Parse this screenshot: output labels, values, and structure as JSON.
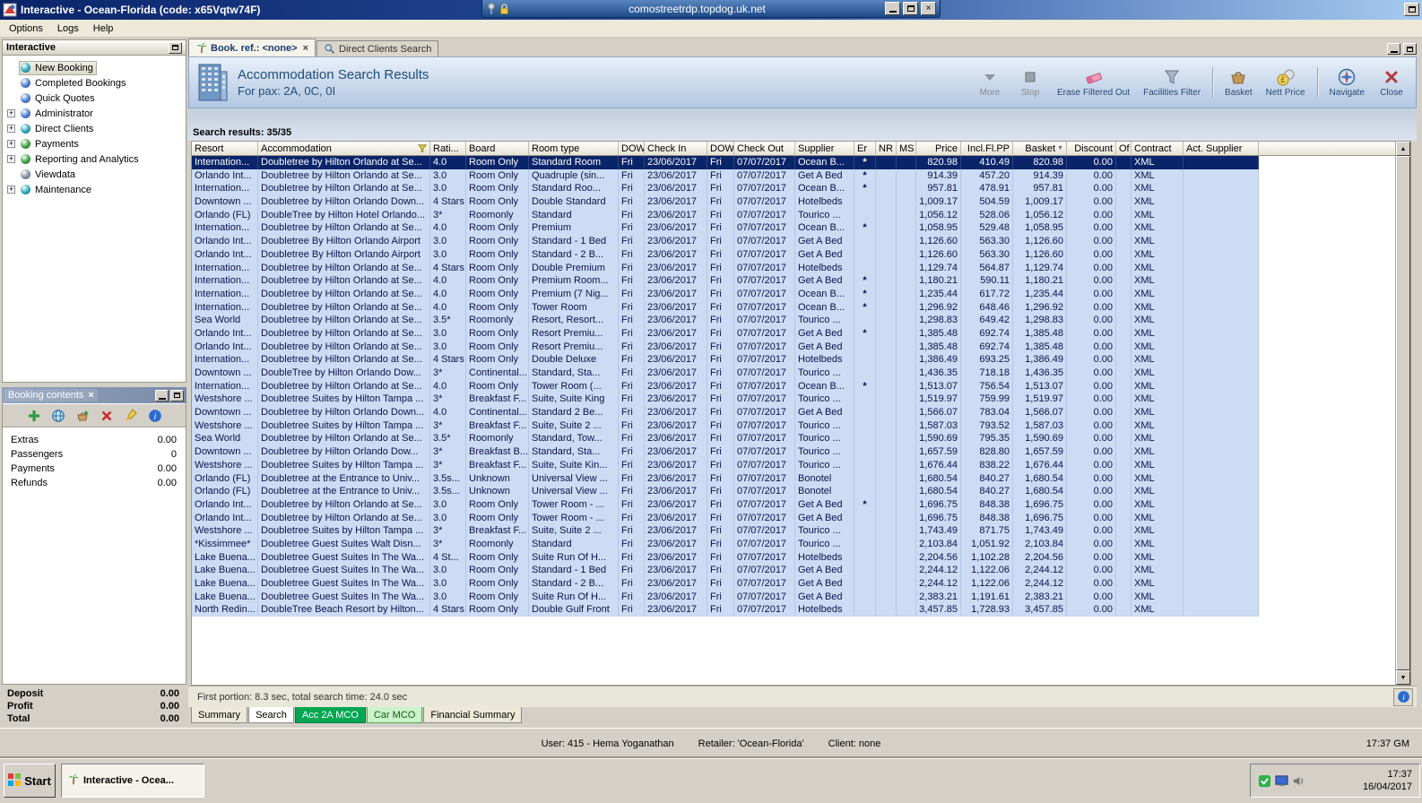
{
  "window": {
    "title": "Interactive - Ocean-Florida (code: x65Vqtw74F)",
    "rdp_host": "comostreetrdp.topdog.uk.net",
    "menu": [
      "Options",
      "Logs",
      "Help"
    ]
  },
  "colors": {
    "titlebar_start": "#0a246a",
    "titlebar_end": "#a6caf0",
    "selection": "#0a246a",
    "row_highlight": "#cbdcf4",
    "green_dark": "#00a651",
    "green_light": "#c9f3c9"
  },
  "sidebar": {
    "title": "Interactive",
    "tree": [
      {
        "label": "New Booking",
        "expandable": false,
        "selected": true,
        "icon_color": "#2aa8b8"
      },
      {
        "label": "Completed Bookings",
        "expandable": false,
        "selected": false,
        "icon_color": "#4a7ad0"
      },
      {
        "label": "Quick Quotes",
        "expandable": false,
        "selected": false,
        "icon_color": "#4a7ad0"
      },
      {
        "label": "Administrator",
        "expandable": true,
        "selected": false,
        "icon_color": "#4a7ad0"
      },
      {
        "label": "Direct Clients",
        "expandable": true,
        "selected": false,
        "icon_color": "#2aa8b8"
      },
      {
        "label": "Payments",
        "expandable": true,
        "selected": false,
        "icon_color": "#3aa03a"
      },
      {
        "label": "Reporting and Analytics",
        "expandable": true,
        "selected": false,
        "icon_color": "#3aa03a"
      },
      {
        "label": "Viewdata",
        "expandable": false,
        "selected": false,
        "icon_color": "#8090a0"
      },
      {
        "label": "Maintenance",
        "expandable": true,
        "selected": false,
        "icon_color": "#2aa8b8"
      }
    ]
  },
  "booking_contents": {
    "title": "Booking contents",
    "rows": [
      {
        "label": "Extras",
        "value": "0.00"
      },
      {
        "label": "Passengers",
        "value": "0"
      },
      {
        "label": "Payments",
        "value": "0.00"
      },
      {
        "label": "Refunds",
        "value": "0.00"
      }
    ],
    "totals": [
      {
        "label": "Deposit",
        "value": "0.00"
      },
      {
        "label": "Profit",
        "value": "0.00"
      },
      {
        "label": "Total",
        "value": "0.00"
      }
    ]
  },
  "workspace": {
    "tabs": [
      {
        "label": "Book. ref.: <none>",
        "active": true,
        "closable": true
      },
      {
        "label": "Direct Clients Search",
        "active": false,
        "closable": false
      }
    ],
    "header": {
      "title": "Accommodation Search Results",
      "subtitle": "For pax: 2A, 0C, 0I"
    },
    "toolbar": [
      {
        "label": "More",
        "icon": "more-icon",
        "disabled": true
      },
      {
        "label": "Stop",
        "icon": "stop-icon",
        "disabled": true
      },
      {
        "label": "Erase Filtered Out",
        "icon": "eraser-icon",
        "disabled": false
      },
      {
        "label": "Facilities Filter",
        "icon": "filter-icon",
        "disabled": false
      },
      {
        "separator": true
      },
      {
        "label": "Basket",
        "icon": "basket-icon",
        "disabled": false
      },
      {
        "label": "Nett Price",
        "icon": "nett-price-icon",
        "disabled": false
      },
      {
        "separator": true
      },
      {
        "label": "Navigate",
        "icon": "navigate-icon",
        "disabled": false
      },
      {
        "label": "Close",
        "icon": "close-icon",
        "disabled": false
      }
    ],
    "results_label": "Search results: 35/35",
    "status_line": "First portion: 8.3 sec, total search time: 24.0 sec",
    "bottom_tabs": [
      {
        "label": "Summary",
        "style": "plain"
      },
      {
        "label": "Search",
        "style": "active"
      },
      {
        "label": "Acc 2A MCO",
        "style": "green-dark"
      },
      {
        "label": "Car MCO",
        "style": "green-light"
      },
      {
        "label": "Financial Summary",
        "style": "plain"
      }
    ]
  },
  "table": {
    "columns": [
      "Resort",
      "Accommodation",
      "Rati...",
      "Board",
      "Room type",
      "DOW",
      "Check In",
      "DOW",
      "Check Out",
      "Supplier",
      "Er",
      "NR",
      "MS",
      "Price",
      "Incl.Fl.PP",
      "Basket",
      "Discount",
      "Of",
      "Contract",
      "Act. Supplier"
    ],
    "selected_row": 0,
    "rows": [
      [
        "Internation...",
        "Doubletree by Hilton Orlando at Se...",
        "4.0",
        "Room Only",
        "Standard Room",
        "Fri",
        "23/06/2017",
        "Fri",
        "07/07/2017",
        "Ocean B...",
        "*",
        "",
        "",
        "820.98",
        "410.49",
        "820.98",
        "0.00",
        "",
        "XML",
        ""
      ],
      [
        "Orlando Int...",
        "Doubletree by Hilton Orlando at Se...",
        "3.0",
        "Room Only",
        "Quadruple (sin...",
        "Fri",
        "23/06/2017",
        "Fri",
        "07/07/2017",
        "Get A Bed",
        "*",
        "",
        "",
        "914.39",
        "457.20",
        "914.39",
        "0.00",
        "",
        "XML",
        ""
      ],
      [
        "Internation...",
        "Doubletree by Hilton Orlando at Se...",
        "3.0",
        "Room Only",
        "Standard Roo...",
        "Fri",
        "23/06/2017",
        "Fri",
        "07/07/2017",
        "Ocean B...",
        "*",
        "",
        "",
        "957.81",
        "478.91",
        "957.81",
        "0.00",
        "",
        "XML",
        ""
      ],
      [
        "Downtown ...",
        "Doubletree by Hilton Orlando Down...",
        "4 Stars",
        "Room Only",
        "Double Standard",
        "Fri",
        "23/06/2017",
        "Fri",
        "07/07/2017",
        "Hotelbeds",
        "",
        "",
        "",
        "1,009.17",
        "504.59",
        "1,009.17",
        "0.00",
        "",
        "XML",
        ""
      ],
      [
        "Orlando (FL)",
        "DoubleTree by Hilton Hotel Orlando...",
        "3*",
        "Roomonly",
        "Standard",
        "Fri",
        "23/06/2017",
        "Fri",
        "07/07/2017",
        "Tourico ...",
        "",
        "",
        "",
        "1,056.12",
        "528.06",
        "1,056.12",
        "0.00",
        "",
        "XML",
        ""
      ],
      [
        "Internation...",
        "Doubletree by Hilton Orlando at Se...",
        "4.0",
        "Room Only",
        "Premium",
        "Fri",
        "23/06/2017",
        "Fri",
        "07/07/2017",
        "Ocean B...",
        "*",
        "",
        "",
        "1,058.95",
        "529.48",
        "1,058.95",
        "0.00",
        "",
        "XML",
        ""
      ],
      [
        "Orlando Int...",
        "Doubletree By Hilton Orlando Airport",
        "3.0",
        "Room Only",
        "Standard - 1 Bed",
        "Fri",
        "23/06/2017",
        "Fri",
        "07/07/2017",
        "Get A Bed",
        "",
        "",
        "",
        "1,126.60",
        "563.30",
        "1,126.60",
        "0.00",
        "",
        "XML",
        ""
      ],
      [
        "Orlando Int...",
        "Doubletree By Hilton Orlando Airport",
        "3.0",
        "Room Only",
        "Standard - 2 B...",
        "Fri",
        "23/06/2017",
        "Fri",
        "07/07/2017",
        "Get A Bed",
        "",
        "",
        "",
        "1,126.60",
        "563.30",
        "1,126.60",
        "0.00",
        "",
        "XML",
        ""
      ],
      [
        "Internation...",
        "Doubletree by Hilton Orlando at Se...",
        "4 Stars",
        "Room Only",
        "Double Premium",
        "Fri",
        "23/06/2017",
        "Fri",
        "07/07/2017",
        "Hotelbeds",
        "",
        "",
        "",
        "1,129.74",
        "564.87",
        "1,129.74",
        "0.00",
        "",
        "XML",
        ""
      ],
      [
        "Internation...",
        "Doubletree by Hilton Orlando at Se...",
        "4.0",
        "Room Only",
        "Premium Room...",
        "Fri",
        "23/06/2017",
        "Fri",
        "07/07/2017",
        "Get A Bed",
        "*",
        "",
        "",
        "1,180.21",
        "590.11",
        "1,180.21",
        "0.00",
        "",
        "XML",
        ""
      ],
      [
        "Internation...",
        "Doubletree by Hilton Orlando at Se...",
        "4.0",
        "Room Only",
        "Premium (7 Nig...",
        "Fri",
        "23/06/2017",
        "Fri",
        "07/07/2017",
        "Ocean B...",
        "*",
        "",
        "",
        "1,235.44",
        "617.72",
        "1,235.44",
        "0.00",
        "",
        "XML",
        ""
      ],
      [
        "Internation...",
        "Doubletree by Hilton Orlando at Se...",
        "4.0",
        "Room Only",
        "Tower Room",
        "Fri",
        "23/06/2017",
        "Fri",
        "07/07/2017",
        "Ocean B...",
        "*",
        "",
        "",
        "1,296.92",
        "648.46",
        "1,296.92",
        "0.00",
        "",
        "XML",
        ""
      ],
      [
        "Sea World",
        "Doubletree by Hilton Orlando at Se...",
        "3.5*",
        "Roomonly",
        "Resort, Resort...",
        "Fri",
        "23/06/2017",
        "Fri",
        "07/07/2017",
        "Tourico ...",
        "",
        "",
        "",
        "1,298.83",
        "649.42",
        "1,298.83",
        "0.00",
        "",
        "XML",
        ""
      ],
      [
        "Orlando Int...",
        "Doubletree by Hilton Orlando at Se...",
        "3.0",
        "Room Only",
        "Resort Premiu...",
        "Fri",
        "23/06/2017",
        "Fri",
        "07/07/2017",
        "Get A Bed",
        "*",
        "",
        "",
        "1,385.48",
        "692.74",
        "1,385.48",
        "0.00",
        "",
        "XML",
        ""
      ],
      [
        "Orlando Int...",
        "Doubletree by Hilton Orlando at Se...",
        "3.0",
        "Room Only",
        "Resort Premiu...",
        "Fri",
        "23/06/2017",
        "Fri",
        "07/07/2017",
        "Get A Bed",
        "",
        "",
        "",
        "1,385.48",
        "692.74",
        "1,385.48",
        "0.00",
        "",
        "XML",
        ""
      ],
      [
        "Internation...",
        "Doubletree by Hilton Orlando at Se...",
        "4 Stars",
        "Room Only",
        "Double Deluxe",
        "Fri",
        "23/06/2017",
        "Fri",
        "07/07/2017",
        "Hotelbeds",
        "",
        "",
        "",
        "1,386.49",
        "693.25",
        "1,386.49",
        "0.00",
        "",
        "XML",
        ""
      ],
      [
        "Downtown ...",
        "DoubleTree by Hilton Orlando Dow...",
        "3*",
        "Continental...",
        "Standard, Sta...",
        "Fri",
        "23/06/2017",
        "Fri",
        "07/07/2017",
        "Tourico ...",
        "",
        "",
        "",
        "1,436.35",
        "718.18",
        "1,436.35",
        "0.00",
        "",
        "XML",
        ""
      ],
      [
        "Internation...",
        "Doubletree by Hilton Orlando at Se...",
        "4.0",
        "Room Only",
        "Tower Room (...",
        "Fri",
        "23/06/2017",
        "Fri",
        "07/07/2017",
        "Ocean B...",
        "*",
        "",
        "",
        "1,513.07",
        "756.54",
        "1,513.07",
        "0.00",
        "",
        "XML",
        ""
      ],
      [
        "Westshore ...",
        "Doubletree Suites by Hilton Tampa ...",
        "3*",
        "Breakfast F...",
        "Suite, Suite King",
        "Fri",
        "23/06/2017",
        "Fri",
        "07/07/2017",
        "Tourico ...",
        "",
        "",
        "",
        "1,519.97",
        "759.99",
        "1,519.97",
        "0.00",
        "",
        "XML",
        ""
      ],
      [
        "Downtown ...",
        "Doubletree by Hilton Orlando Down...",
        "4.0",
        "Continental...",
        "Standard 2 Be...",
        "Fri",
        "23/06/2017",
        "Fri",
        "07/07/2017",
        "Get A Bed",
        "",
        "",
        "",
        "1,566.07",
        "783.04",
        "1,566.07",
        "0.00",
        "",
        "XML",
        ""
      ],
      [
        "Westshore ...",
        "Doubletree Suites by Hilton Tampa ...",
        "3*",
        "Breakfast F...",
        "Suite, Suite 2 ...",
        "Fri",
        "23/06/2017",
        "Fri",
        "07/07/2017",
        "Tourico ...",
        "",
        "",
        "",
        "1,587.03",
        "793.52",
        "1,587.03",
        "0.00",
        "",
        "XML",
        ""
      ],
      [
        "Sea World",
        "Doubletree by Hilton Orlando at Se...",
        "3.5*",
        "Roomonly",
        "Standard, Tow...",
        "Fri",
        "23/06/2017",
        "Fri",
        "07/07/2017",
        "Tourico ...",
        "",
        "",
        "",
        "1,590.69",
        "795.35",
        "1,590.69",
        "0.00",
        "",
        "XML",
        ""
      ],
      [
        "Downtown ...",
        "Doubletree by Hilton Orlando Dow...",
        "3*",
        "Breakfast B...",
        "Standard, Sta...",
        "Fri",
        "23/06/2017",
        "Fri",
        "07/07/2017",
        "Tourico ...",
        "",
        "",
        "",
        "1,657.59",
        "828.80",
        "1,657.59",
        "0.00",
        "",
        "XML",
        ""
      ],
      [
        "Westshore ...",
        "Doubletree Suites by Hilton Tampa ...",
        "3*",
        "Breakfast F...",
        "Suite, Suite Kin...",
        "Fri",
        "23/06/2017",
        "Fri",
        "07/07/2017",
        "Tourico ...",
        "",
        "",
        "",
        "1,676.44",
        "838.22",
        "1,676.44",
        "0.00",
        "",
        "XML",
        ""
      ],
      [
        "Orlando (FL)",
        "Doubletree at the Entrance to Univ...",
        "3.5s...",
        "Unknown",
        "Universal View ...",
        "Fri",
        "23/06/2017",
        "Fri",
        "07/07/2017",
        "Bonotel",
        "",
        "",
        "",
        "1,680.54",
        "840.27",
        "1,680.54",
        "0.00",
        "",
        "XML",
        ""
      ],
      [
        "Orlando (FL)",
        "Doubletree at the Entrance to Univ...",
        "3.5s...",
        "Unknown",
        "Universal View ...",
        "Fri",
        "23/06/2017",
        "Fri",
        "07/07/2017",
        "Bonotel",
        "",
        "",
        "",
        "1,680.54",
        "840.27",
        "1,680.54",
        "0.00",
        "",
        "XML",
        ""
      ],
      [
        "Orlando Int...",
        "Doubletree by Hilton Orlando at Se...",
        "3.0",
        "Room Only",
        "Tower Room - ...",
        "Fri",
        "23/06/2017",
        "Fri",
        "07/07/2017",
        "Get A Bed",
        "*",
        "",
        "",
        "1,696.75",
        "848.38",
        "1,696.75",
        "0.00",
        "",
        "XML",
        ""
      ],
      [
        "Orlando Int...",
        "Doubletree by Hilton Orlando at Se...",
        "3.0",
        "Room Only",
        "Tower Room - ...",
        "Fri",
        "23/06/2017",
        "Fri",
        "07/07/2017",
        "Get A Bed",
        "",
        "",
        "",
        "1,696.75",
        "848.38",
        "1,696.75",
        "0.00",
        "",
        "XML",
        ""
      ],
      [
        "Westshore ...",
        "Doubletree Suites by Hilton Tampa ...",
        "3*",
        "Breakfast F...",
        "Suite, Suite 2 ...",
        "Fri",
        "23/06/2017",
        "Fri",
        "07/07/2017",
        "Tourico ...",
        "",
        "",
        "",
        "1,743.49",
        "871.75",
        "1,743.49",
        "0.00",
        "",
        "XML",
        ""
      ],
      [
        "*Kissimmee*",
        "Doubletree Guest Suites Walt Disn...",
        "3*",
        "Roomonly",
        "Standard",
        "Fri",
        "23/06/2017",
        "Fri",
        "07/07/2017",
        "Tourico ...",
        "",
        "",
        "",
        "2,103.84",
        "1,051.92",
        "2,103.84",
        "0.00",
        "",
        "XML",
        ""
      ],
      [
        "Lake Buena...",
        "Doubletree Guest Suites In The Wa...",
        "4 St...",
        "Room Only",
        "Suite Run Of H...",
        "Fri",
        "23/06/2017",
        "Fri",
        "07/07/2017",
        "Hotelbeds",
        "",
        "",
        "",
        "2,204.56",
        "1,102.28",
        "2,204.56",
        "0.00",
        "",
        "XML",
        ""
      ],
      [
        "Lake Buena...",
        "Doubletree Guest Suites In The Wa...",
        "3.0",
        "Room Only",
        "Standard - 1 Bed",
        "Fri",
        "23/06/2017",
        "Fri",
        "07/07/2017",
        "Get A Bed",
        "",
        "",
        "",
        "2,244.12",
        "1,122.06",
        "2,244.12",
        "0.00",
        "",
        "XML",
        ""
      ],
      [
        "Lake Buena...",
        "Doubletree Guest Suites In The Wa...",
        "3.0",
        "Room Only",
        "Standard - 2 B...",
        "Fri",
        "23/06/2017",
        "Fri",
        "07/07/2017",
        "Get A Bed",
        "",
        "",
        "",
        "2,244.12",
        "1,122.06",
        "2,244.12",
        "0.00",
        "",
        "XML",
        ""
      ],
      [
        "Lake Buena...",
        "Doubletree Guest Suites In The Wa...",
        "3.0",
        "Room Only",
        "Suite Run Of H...",
        "Fri",
        "23/06/2017",
        "Fri",
        "07/07/2017",
        "Get A Bed",
        "",
        "",
        "",
        "2,383.21",
        "1,191.61",
        "2,383.21",
        "0.00",
        "",
        "XML",
        ""
      ],
      [
        "North Redin...",
        "DoubleTree Beach Resort by Hilton...",
        "4 Stars",
        "Room Only",
        "Double Gulf Front",
        "Fri",
        "23/06/2017",
        "Fri",
        "07/07/2017",
        "Hotelbeds",
        "",
        "",
        "",
        "3,457.85",
        "1,728.93",
        "3,457.85",
        "0.00",
        "",
        "XML",
        ""
      ]
    ]
  },
  "statusbar": {
    "user": "User: 415 - Hema Yoganathan",
    "retailer": "Retailer: 'Ocean-Florida'",
    "client": "Client: none",
    "time": "17:37 GM"
  },
  "taskbar": {
    "start_label": "Start",
    "task_label": "Interactive - Ocea...",
    "clock_time": "17:37",
    "clock_date": "16/04/2017"
  }
}
